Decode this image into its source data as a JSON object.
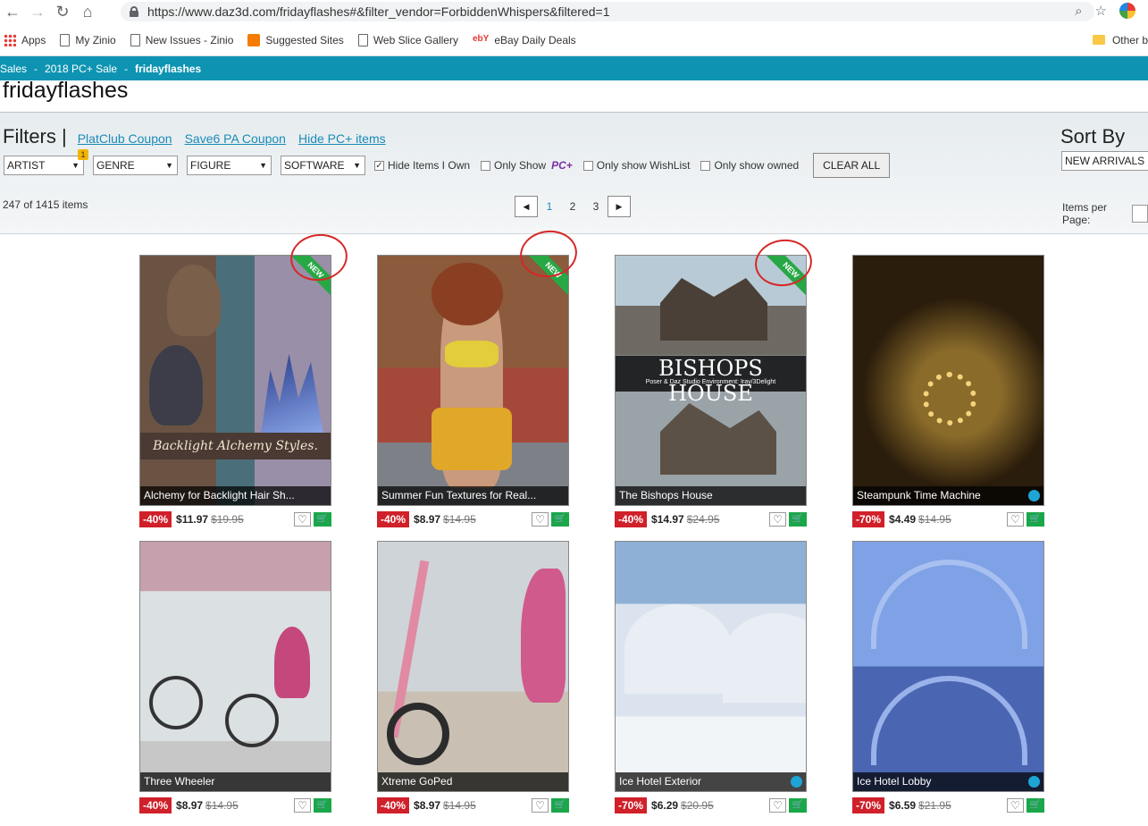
{
  "browser": {
    "url": "https://www.daz3d.com/fridayflashes#&filter_vendor=ForbiddenWhispers&filtered=1",
    "bookmarks": [
      "Apps",
      "My Zinio",
      "New Issues - Zinio",
      "Suggested Sites",
      "Web Slice Gallery",
      "eBay Daily Deals"
    ],
    "ebay_glyph": "ebY",
    "other_bookmarks": "Other b"
  },
  "breadcrumb": {
    "items": [
      "Sales",
      "2018 PC+ Sale"
    ],
    "current": "fridayflashes",
    "separator": "-"
  },
  "page_title": "fridayflashes",
  "filters": {
    "title": "Filters |",
    "links": [
      "PlatClub Coupon",
      "Save6 PA Coupon",
      "Hide PC+ items"
    ],
    "selects": [
      "ARTIST",
      "GENRE",
      "FIGURE",
      "SOFTWARE"
    ],
    "artist_badge": "1",
    "check_hide_owned": "Hide Items I Own",
    "check_only_show": "Only Show",
    "pcplus_logo": "PC+",
    "check_wishlist": "Only show WishList",
    "check_owned": "Only show owned",
    "clear_all": "CLEAR ALL",
    "sort_title": "Sort By",
    "sort_value": "NEW ARRIVALS",
    "count": "247 of 1415 items",
    "pages": [
      "1",
      "2",
      "3"
    ],
    "items_per_page": "Items per Page:"
  },
  "products": [
    {
      "name": "Alchemy for Backlight Hair Sh...",
      "discount": "-40%",
      "price": "$11.97",
      "old_price": "$19.95",
      "is_new": true,
      "new_label": "NEW",
      "art_text": "Backlight Alchemy Styles."
    },
    {
      "name": "Summer Fun Textures for Real...",
      "discount": "-40%",
      "price": "$8.97",
      "old_price": "$14.95",
      "is_new": true,
      "new_label": "NEW"
    },
    {
      "name": "The Bishops House",
      "discount": "-40%",
      "price": "$14.97",
      "old_price": "$24.95",
      "is_new": true,
      "new_label": "NEW",
      "art_text": "BISHOPS HOUSE",
      "art_sub": "Poser & Daz Studio Environment: Iray/3Delight"
    },
    {
      "name": "Steampunk Time Machine",
      "discount": "-70%",
      "price": "$4.49",
      "old_price": "$14.95",
      "is_new": false
    },
    {
      "name": "Three Wheeler",
      "discount": "-40%",
      "price": "$8.97",
      "old_price": "$14.95",
      "is_new": false
    },
    {
      "name": "Xtreme GoPed",
      "discount": "-40%",
      "price": "$8.97",
      "old_price": "$14.95",
      "is_new": false
    },
    {
      "name": "Ice Hotel Exterior",
      "discount": "-70%",
      "price": "$6.29",
      "old_price": "$20.95",
      "is_new": false
    },
    {
      "name": "Ice Hotel Lobby",
      "discount": "-70%",
      "price": "$6.59",
      "old_price": "$21.95",
      "is_new": false
    }
  ],
  "colors": {
    "brand_bar": "#0e94b2",
    "discount": "#d0202a",
    "cart": "#1aa74a",
    "new_ribbon": "#28a745",
    "annotation": "#d62828"
  }
}
